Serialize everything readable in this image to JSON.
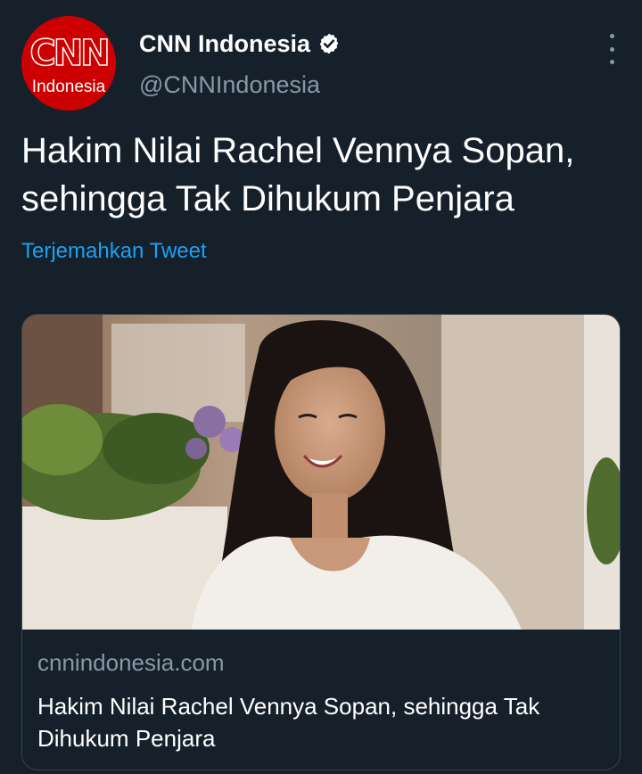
{
  "account": {
    "display_name": "CNN Indonesia",
    "handle": "@CNNIndonesia",
    "verified": true,
    "avatar": {
      "logo_text": "CNN",
      "sub_text": "Indonesia",
      "background": "#cc0000"
    }
  },
  "tweet": {
    "text": "Hakim Nilai Rachel Vennya Sopan, sehingga Tak Dihukum Penjara",
    "translate_label": "Terjemahkan Tweet"
  },
  "link_card": {
    "domain": "cnnindonesia.com",
    "title": "Hakim Nilai Rachel Vennya Sopan, sehingga Tak Dihukum Penjara"
  },
  "icons": {
    "verified": "verified-badge-icon",
    "more": "more-options-icon"
  },
  "colors": {
    "background": "#15202b",
    "text_primary": "#ffffff",
    "text_secondary": "#8899a6",
    "link": "#1da1f2",
    "card_border": "#38444d"
  }
}
